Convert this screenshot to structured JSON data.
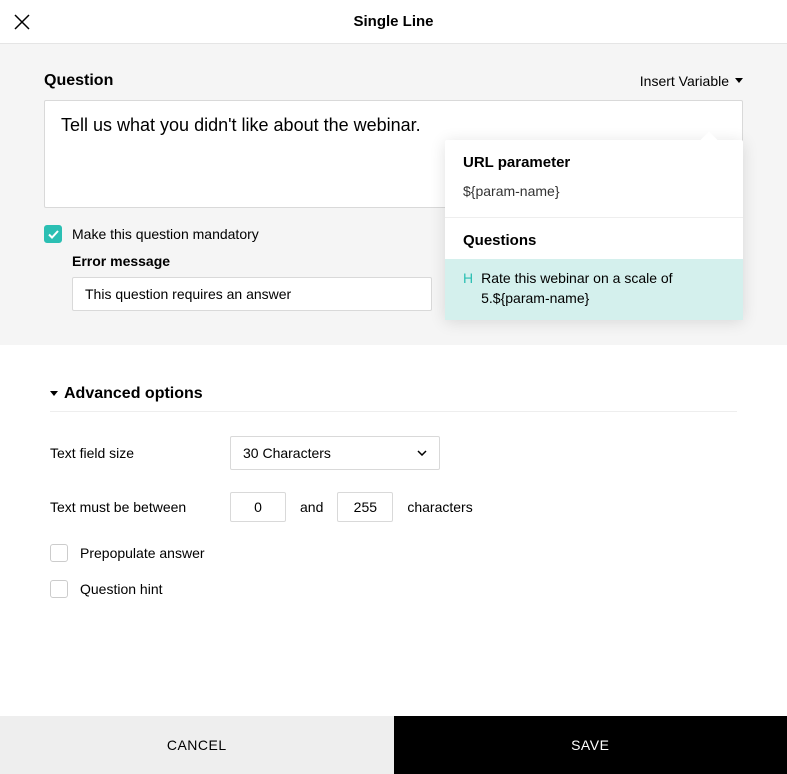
{
  "header": {
    "title": "Single Line"
  },
  "question": {
    "label": "Question",
    "insert_variable_label": "Insert Variable",
    "input_value": "Tell us what you didn't like about the webinar.",
    "mandatory_label": "Make this question mandatory",
    "mandatory_checked": true,
    "error_message_label": "Error message",
    "error_message_value": "This question requires an answer"
  },
  "dropdown": {
    "url_param_heading": "URL parameter",
    "url_param_value": "${param-name}",
    "questions_heading": "Questions",
    "question_prefix": "H",
    "question_item": "Rate this webinar on a scale of 5.${param-name}"
  },
  "advanced": {
    "heading": "Advanced options",
    "text_field_size_label": "Text field size",
    "text_field_size_value": "30 Characters",
    "between_label": "Text must be between",
    "min_value": "0",
    "and_label": "and",
    "max_value": "255",
    "characters_label": "characters",
    "prepopulate_label": "Prepopulate answer",
    "prepopulate_checked": false,
    "hint_label": "Question hint",
    "hint_checked": false
  },
  "footer": {
    "cancel": "CANCEL",
    "save": "SAVE"
  }
}
